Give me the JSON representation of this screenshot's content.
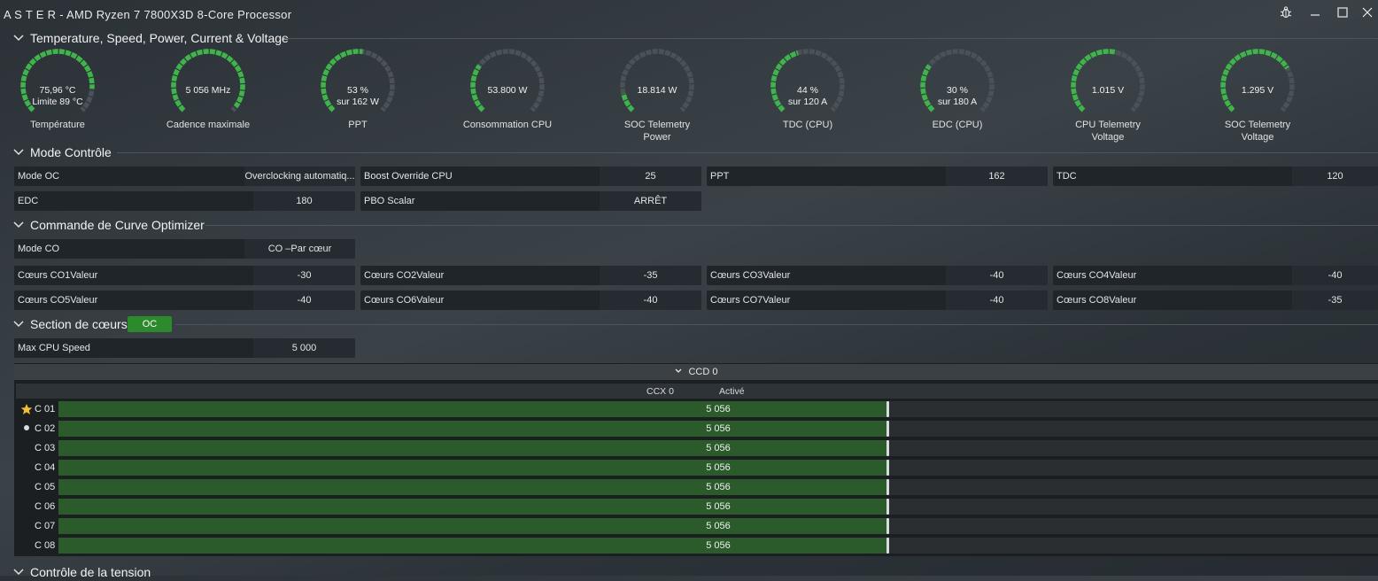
{
  "window": {
    "title": "A S T E R   -  AMD Ryzen 7 7800X3D 8-Core Processor",
    "icons": [
      "bug-icon",
      "minimize-icon",
      "maximize-icon",
      "close-icon"
    ]
  },
  "sections": {
    "temp": "Temperature, Speed, Power, Current & Voltage",
    "mode": "Mode Contrôle",
    "curve": "Commande de Curve Optimizer",
    "cores": "Section de cœurs",
    "voltage": "Contrôle de la tension"
  },
  "gauges": [
    {
      "line1": "75,96 °C",
      "line2": "Limite 89 °C",
      "label1": "Température",
      "label2": "",
      "fill": 0.85
    },
    {
      "line1": "5 056  MHz",
      "line2": "",
      "label1": "Cadence maximale",
      "label2": "",
      "fill": 0.97
    },
    {
      "line1": "53 %",
      "line2": "sur 162 W",
      "label1": "PPT",
      "label2": "",
      "fill": 0.53
    },
    {
      "line1": "53.800 W",
      "line2": "",
      "label1": "Consommation CPU",
      "label2": "",
      "fill": 0.3
    },
    {
      "line1": "18.814 W",
      "line2": "",
      "label1": "SOC Telemetry",
      "label2": "Power",
      "fill": 0.12
    },
    {
      "line1": "44 %",
      "line2": "sur 120 A",
      "label1": "TDC (CPU)",
      "label2": "",
      "fill": 0.44
    },
    {
      "line1": "30 %",
      "line2": "sur 180 A",
      "label1": "EDC (CPU)",
      "label2": "",
      "fill": 0.3
    },
    {
      "line1": "1.015 V",
      "line2": "",
      "label1": "CPU Telemetry",
      "label2": "Voltage",
      "fill": 0.55
    },
    {
      "line1": "1.295 V",
      "line2": "",
      "label1": "SOC Telemetry",
      "label2": "Voltage",
      "fill": 0.72
    }
  ],
  "colors": {
    "gauge_fill": "#3fb44a",
    "gauge_track": "#4a5258",
    "accent": "#2c8a2c"
  },
  "mode_control": [
    {
      "key": "Mode OC",
      "value": "Overclocking automatiq..."
    },
    {
      "key": "Boost Override CPU",
      "value": "25"
    },
    {
      "key": "PPT",
      "value": "162"
    },
    {
      "key": "TDC",
      "value": "120"
    },
    {
      "key": "EDC",
      "value": "180"
    },
    {
      "key": "PBO Scalar",
      "value": "ARRÊT"
    }
  ],
  "curve": {
    "mode": {
      "key": "Mode CO",
      "value": "CO –Par cœur"
    },
    "cores": [
      {
        "key": "Cœurs CO1Valeur",
        "value": "-30"
      },
      {
        "key": "Cœurs CO2Valeur",
        "value": "-35"
      },
      {
        "key": "Cœurs CO3Valeur",
        "value": "-40"
      },
      {
        "key": "Cœurs CO4Valeur",
        "value": "-40"
      },
      {
        "key": "Cœurs CO5Valeur",
        "value": "-40"
      },
      {
        "key": "Cœurs CO6Valeur",
        "value": "-40"
      },
      {
        "key": "Cœurs CO7Valeur",
        "value": "-40"
      },
      {
        "key": "Cœurs CO8Valeur",
        "value": "-35"
      }
    ]
  },
  "core_section": {
    "badge": "OC",
    "max_speed": {
      "key": "Max CPU Speed",
      "value": "5 000"
    },
    "ccd_title": "CCD 0",
    "ccx_label": "CCX 0",
    "ccx_status": "Activé",
    "bar_fraction": 0.6277,
    "cores": [
      {
        "name": "C 01",
        "value": "5 056",
        "marker": "star-icon"
      },
      {
        "name": "C 02",
        "value": "5 056",
        "marker": "dot-icon"
      },
      {
        "name": "C 03",
        "value": "5 056",
        "marker": ""
      },
      {
        "name": "C 04",
        "value": "5 056",
        "marker": ""
      },
      {
        "name": "C 05",
        "value": "5 056",
        "marker": ""
      },
      {
        "name": "C 06",
        "value": "5 056",
        "marker": ""
      },
      {
        "name": "C 07",
        "value": "5 056",
        "marker": ""
      },
      {
        "name": "C 08",
        "value": "5 056",
        "marker": ""
      }
    ]
  }
}
